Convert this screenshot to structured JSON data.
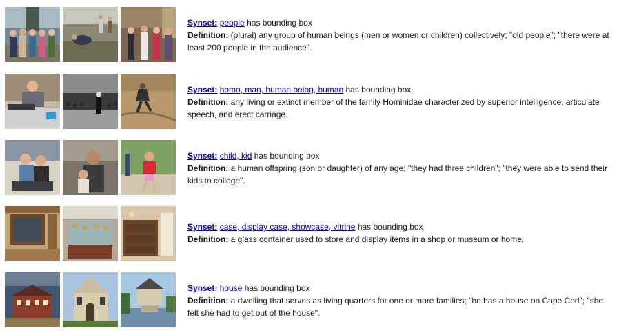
{
  "entries": [
    {
      "synset_label": "Synset:",
      "synset_words": "people",
      "suffix": "has bounding box",
      "definition_label": "Definition:",
      "definition": "(plural) any group of human beings (men or women or children) collectively; \"old people\"; \"there were at least 200 people in the audience\".",
      "thumbnails": [
        "group-photo-thumbnail",
        "people-in-field-thumbnail",
        "crowd-street-thumbnail"
      ]
    },
    {
      "synset_label": "Synset:",
      "synset_words": "homo, man, human being, human",
      "suffix": "has bounding box",
      "definition_label": "Definition:",
      "definition": "any living or extinct member of the family Hominidae characterized by superior intelligence, articulate speech, and erect carriage.",
      "thumbnails": [
        "man-reclining-thumbnail",
        "street-performer-thumbnail",
        "man-on-beach-thumbnail"
      ]
    },
    {
      "synset_label": "Synset:",
      "synset_words": "child, kid",
      "suffix": "has bounding box",
      "definition_label": "Definition:",
      "definition": "a human offspring (son or daughter) of any age; \"they had three children\"; \"they were able to send their kids to college\".",
      "thumbnails": [
        "children-group-thumbnail",
        "child-with-adult-thumbnail",
        "child-running-thumbnail"
      ]
    },
    {
      "synset_label": "Synset:",
      "synset_words": "case, display case, showcase, vitrine",
      "suffix": "has bounding box",
      "definition_label": "Definition:",
      "definition": "a glass container used to store and display items in a shop or museum or home.",
      "thumbnails": [
        "wooden-cabinet-thumbnail",
        "glass-showcase-thumbnail",
        "dresser-thumbnail"
      ]
    },
    {
      "synset_label": "Synset:",
      "synset_words": "house",
      "suffix": "has bounding box",
      "definition_label": "Definition:",
      "definition": "a dwelling that serves as living quarters for one or more families; \"he has a house on Cape Cod\"; \"she felt she had to get out of the house\".",
      "thumbnails": [
        "brick-house-thumbnail",
        "stone-house-thumbnail",
        "house-on-water-thumbnail"
      ]
    }
  ]
}
